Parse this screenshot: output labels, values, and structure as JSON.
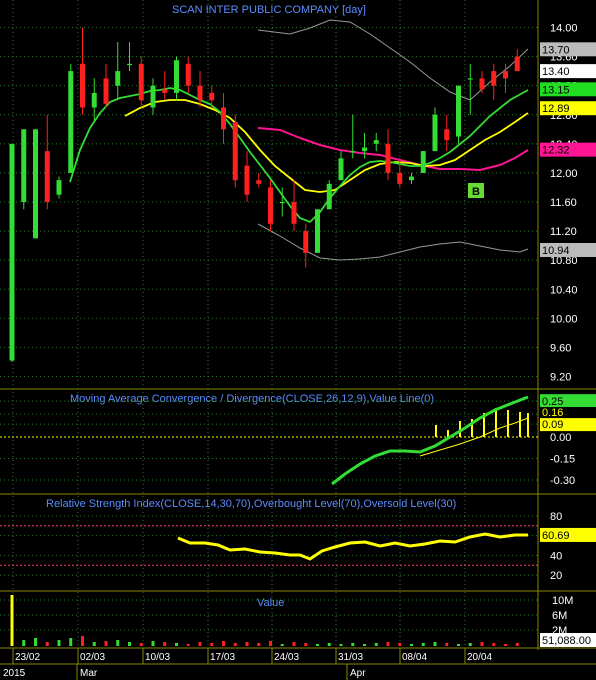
{
  "chart_data": [
    {
      "type": "candlestick",
      "title": "SCAN INTER PUBLIC COMPANY [day]",
      "ylim": [
        9.0,
        14.2
      ],
      "yticks": [
        "14.00",
        "13.60",
        "13.20",
        "12.80",
        "12.40",
        "12.00",
        "11.60",
        "11.20",
        "10.80",
        "10.40",
        "10.00",
        "9.60",
        "9.20"
      ],
      "grid": true,
      "candles": [
        {
          "date": "2015-02-23",
          "open": 9.42,
          "high": 12.4,
          "low": 9.4,
          "close": 12.4
        },
        {
          "date": "2015-02-24",
          "open": 11.6,
          "high": 12.6,
          "low": 11.5,
          "close": 12.6
        },
        {
          "date": "2015-02-25",
          "open": 11.1,
          "high": 12.6,
          "low": 11.1,
          "close": 12.6
        },
        {
          "date": "2015-02-26",
          "open": 12.3,
          "high": 12.8,
          "low": 11.5,
          "close": 11.6
        },
        {
          "date": "2015-02-27",
          "open": 11.7,
          "high": 11.95,
          "low": 11.65,
          "close": 11.9
        },
        {
          "date": "2015-03-02",
          "open": 12.0,
          "high": 13.5,
          "low": 12.0,
          "close": 13.4
        },
        {
          "date": "2015-03-03",
          "open": 13.5,
          "high": 14.0,
          "low": 12.8,
          "close": 12.9
        },
        {
          "date": "2015-03-04",
          "open": 12.9,
          "high": 13.3,
          "low": 12.7,
          "close": 13.1
        },
        {
          "date": "2015-03-05",
          "open": 13.3,
          "high": 13.5,
          "low": 12.9,
          "close": 12.95
        },
        {
          "date": "2015-03-06",
          "open": 13.2,
          "high": 13.8,
          "low": 13.0,
          "close": 13.4
        },
        {
          "date": "2015-03-09",
          "open": 13.5,
          "high": 13.8,
          "low": 13.4,
          "close": 13.5
        },
        {
          "date": "2015-03-10",
          "open": 13.5,
          "high": 13.6,
          "low": 12.9,
          "close": 13.0
        },
        {
          "date": "2015-03-11",
          "open": 12.9,
          "high": 13.3,
          "low": 12.8,
          "close": 13.2
        },
        {
          "date": "2015-03-12",
          "open": 13.15,
          "high": 13.4,
          "low": 13.0,
          "close": 13.1
        },
        {
          "date": "2015-03-13",
          "open": 13.1,
          "high": 13.6,
          "low": 13.0,
          "close": 13.55
        },
        {
          "date": "2015-03-16",
          "open": 13.5,
          "high": 13.6,
          "low": 13.1,
          "close": 13.2
        },
        {
          "date": "2015-03-17",
          "open": 13.2,
          "high": 13.4,
          "low": 12.9,
          "close": 13.0
        },
        {
          "date": "2015-03-18",
          "open": 13.1,
          "high": 13.2,
          "low": 12.9,
          "close": 13.0
        },
        {
          "date": "2015-03-19",
          "open": 12.9,
          "high": 13.1,
          "low": 12.4,
          "close": 12.6
        },
        {
          "date": "2015-03-20",
          "open": 12.7,
          "high": 12.8,
          "low": 11.8,
          "close": 11.9
        },
        {
          "date": "2015-03-23",
          "open": 12.1,
          "high": 12.3,
          "low": 11.6,
          "close": 11.7
        },
        {
          "date": "2015-03-24",
          "open": 11.9,
          "high": 12.0,
          "low": 11.8,
          "close": 11.85
        },
        {
          "date": "2015-03-25",
          "open": 11.8,
          "high": 11.9,
          "low": 11.2,
          "close": 11.3
        },
        {
          "date": "2015-03-26",
          "open": 11.6,
          "high": 11.8,
          "low": 11.4,
          "close": 11.6
        },
        {
          "date": "2015-03-27",
          "open": 11.6,
          "high": 11.9,
          "low": 11.2,
          "close": 11.3
        },
        {
          "date": "2015-03-30",
          "open": 11.2,
          "high": 11.3,
          "low": 10.7,
          "close": 10.9
        },
        {
          "date": "2015-03-31",
          "open": 10.9,
          "high": 11.5,
          "low": 10.9,
          "close": 11.5
        },
        {
          "date": "2015-04-01",
          "open": 11.5,
          "high": 11.9,
          "low": 11.5,
          "close": 11.85
        },
        {
          "date": "2015-04-02",
          "open": 11.9,
          "high": 12.3,
          "low": 11.9,
          "close": 12.2
        },
        {
          "date": "2015-04-03",
          "open": 12.3,
          "high": 12.8,
          "low": 12.2,
          "close": 12.3
        },
        {
          "date": "2015-04-07",
          "open": 12.3,
          "high": 12.55,
          "low": 12.2,
          "close": 12.35
        },
        {
          "date": "2015-04-08",
          "open": 12.4,
          "high": 12.55,
          "low": 12.3,
          "close": 12.45
        },
        {
          "date": "2015-04-09",
          "open": 12.4,
          "high": 12.6,
          "low": 11.9,
          "close": 12.0
        },
        {
          "date": "2015-04-10",
          "open": 12.0,
          "high": 12.2,
          "low": 11.8,
          "close": 11.85
        },
        {
          "date": "2015-04-13",
          "open": 11.9,
          "high": 12.0,
          "low": 11.85,
          "close": 11.95
        },
        {
          "date": "2015-04-16",
          "open": 12.0,
          "high": 12.3,
          "low": 12.0,
          "close": 12.3
        },
        {
          "date": "2015-04-17",
          "open": 12.3,
          "high": 12.9,
          "low": 12.3,
          "close": 12.8
        },
        {
          "date": "2015-04-20",
          "open": 12.6,
          "high": 12.8,
          "low": 12.3,
          "close": 12.45
        },
        {
          "date": "2015-04-21",
          "open": 12.5,
          "high": 13.2,
          "low": 12.4,
          "close": 13.2
        },
        {
          "date": "2015-04-22",
          "open": 13.3,
          "high": 13.5,
          "low": 12.8,
          "close": 13.3
        },
        {
          "date": "2015-04-23",
          "open": 13.3,
          "high": 13.4,
          "low": 13.1,
          "close": 13.15
        },
        {
          "date": "2015-04-24",
          "open": 13.4,
          "high": 13.5,
          "low": 13.0,
          "close": 13.2
        },
        {
          "date": "2015-04-27",
          "open": 13.4,
          "high": 13.5,
          "low": 13.1,
          "close": 13.3
        },
        {
          "date": "2015-04-28",
          "open": 13.6,
          "high": 13.7,
          "low": 13.4,
          "close": 13.4
        }
      ],
      "series": [
        {
          "label": "13.70",
          "color": "#bbbbbb",
          "last": 13.7
        },
        {
          "label": "13.40",
          "color": "#ffffff",
          "last": 13.4
        },
        {
          "label": "13.15",
          "color": "#22dd22",
          "last": 13.15
        },
        {
          "label": "12.89",
          "color": "#ffff00",
          "last": 12.89
        },
        {
          "label": "12.32",
          "color": "#ff1493",
          "last": 12.32
        },
        {
          "label": "10.94",
          "color": "#bbbbbb",
          "last": 10.94
        }
      ],
      "annotations": [
        {
          "text": "B",
          "date": "2015-04-20",
          "color": "#66dd33"
        }
      ],
      "xlabels": [
        "23/02",
        "02/03",
        "10/03",
        "17/03",
        "24/03",
        "31/03",
        "08/04",
        "20/04"
      ],
      "period_labels": [
        "2015",
        "Mar",
        "Apr"
      ]
    },
    {
      "type": "line",
      "title": "Moving Average Convergence / Divergence(CLOSE,26,12,9),Value Line(0)",
      "ylim": [
        -0.38,
        0.3
      ],
      "yticks": [
        "0.25",
        "0.16",
        "0.09",
        "0.00",
        "-0.15",
        "-0.30"
      ],
      "series": [
        {
          "label": "0.25",
          "color": "#33dd33",
          "last": 0.25
        },
        {
          "label": "0.16",
          "color": "#ffff00",
          "last": 0.16
        },
        {
          "label": "0.09",
          "color": "#ffff00",
          "last": 0.09
        }
      ]
    },
    {
      "type": "line",
      "title": "Relative Strength Index(CLOSE,14,30,70),Overbought Level(70),Oversold Level(30)",
      "ylim": [
        15,
        88
      ],
      "yticks": [
        "80",
        "60",
        "40",
        "20"
      ],
      "levels": [
        70,
        30
      ],
      "series": [
        {
          "label": "60.69",
          "color": "#ffff00",
          "last": 60.69
        }
      ]
    },
    {
      "type": "bar",
      "title": "Value",
      "yticks": [
        "10M",
        "6M",
        "2M"
      ],
      "series": [
        {
          "label": "51,088.00",
          "color": "#ffffff",
          "last": 51088.0
        }
      ]
    }
  ]
}
